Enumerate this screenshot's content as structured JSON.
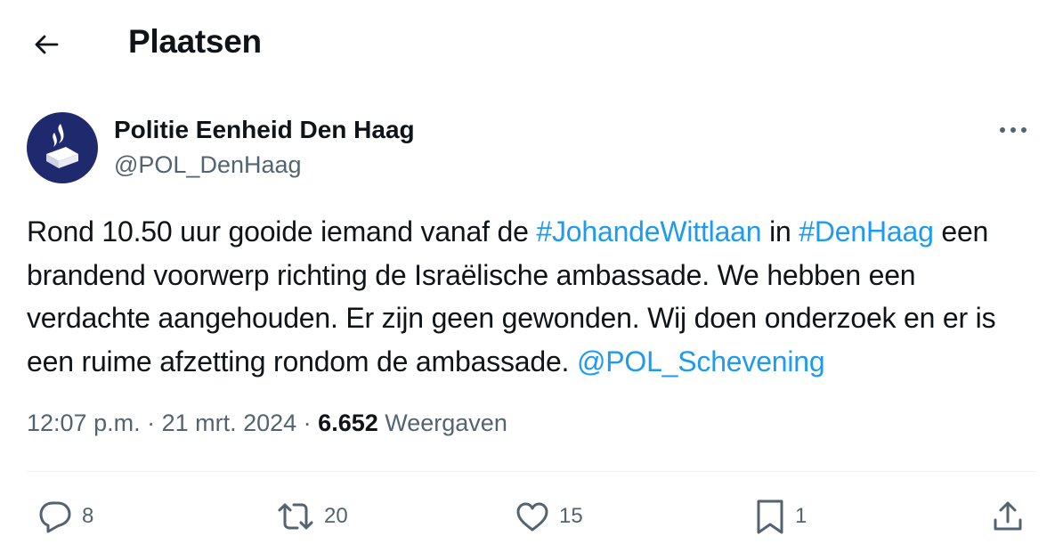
{
  "header": {
    "title": "Plaatsen"
  },
  "author": {
    "name": "Politie Eenheid Den Haag",
    "handle": "@POL_DenHaag"
  },
  "tweet": {
    "text_part1": "Rond 10.50 uur gooide iemand vanaf de ",
    "hashtag1": "#JohandeWittlaan",
    "text_part2": " in ",
    "hashtag2": "#DenHaag",
    "text_part3": " een brandend voorwerp richting de Israëlische ambassade. We hebben een verdachte aangehouden. Er zijn geen gewonden. Wij doen onderzoek en er is een ruime afzetting rondom de ambassade. ",
    "mention": "@POL_Schevening"
  },
  "meta": {
    "time": "12:07 p.m.",
    "separator1": " · ",
    "date": "21 mrt. 2024",
    "separator2": " · ",
    "views_count": "6.652",
    "views_label": " Weergaven"
  },
  "actions": {
    "replies": "8",
    "reposts": "20",
    "likes": "15",
    "bookmarks": "1"
  },
  "colors": {
    "link": "#1d9bf0",
    "muted": "#536471",
    "text": "#0f1419",
    "avatar_bg": "#1f2a6e"
  }
}
